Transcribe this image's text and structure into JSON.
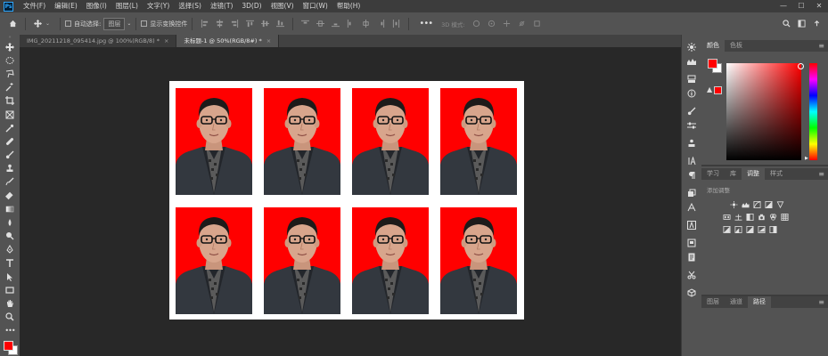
{
  "menubar": {
    "logo": "Ps",
    "items": [
      "文件(F)",
      "编辑(E)",
      "图像(I)",
      "图层(L)",
      "文字(Y)",
      "选择(S)",
      "滤镜(T)",
      "3D(D)",
      "视图(V)",
      "窗口(W)",
      "帮助(H)"
    ],
    "minimize": "—",
    "maximize": "☐",
    "close": "✕"
  },
  "options": {
    "auto_select_label": "自动选择:",
    "auto_select_value": "图层",
    "transform_label": "显示变换控件",
    "mode_3d": "3D 模式:"
  },
  "tabs": [
    {
      "label": "IMG_20211218_095414.jpg @ 100%(RGB/8) *",
      "close": "×"
    },
    {
      "label": "未标题-1 @ 50%(RGB/8#) *",
      "close": "×"
    }
  ],
  "color_panel": {
    "tabs": [
      "颜色",
      "色板"
    ]
  },
  "adjust_panel": {
    "tabs": [
      "学习",
      "库",
      "调整",
      "样式"
    ],
    "add_label": "添加调整"
  },
  "layers_panel": {
    "tabs": [
      "图层",
      "通道",
      "路径"
    ]
  },
  "photos": [
    {
      "row": 1,
      "col": 1
    },
    {
      "row": 1,
      "col": 2
    },
    {
      "row": 1,
      "col": 3
    },
    {
      "row": 1,
      "col": 4
    },
    {
      "row": 2,
      "col": 1
    },
    {
      "row": 2,
      "col": 2
    },
    {
      "row": 2,
      "col": 3
    },
    {
      "row": 2,
      "col": 4
    }
  ],
  "colors": {
    "accent": "#31a8ff",
    "photo_bg": "#ff0000",
    "foreground": "#ff0000",
    "background": "#ffffff"
  }
}
